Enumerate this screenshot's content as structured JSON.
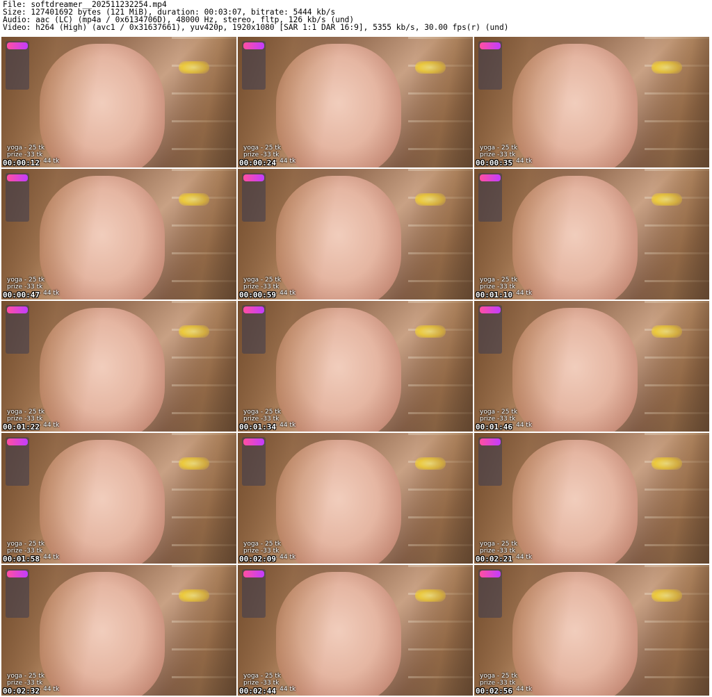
{
  "header": {
    "file": "File: softdreamer__202511232254.mp4",
    "size": "Size: 127401692 bytes (121 MiB), duration: 00:03:07, bitrate: 5444 kb/s",
    "audio": "Audio: aac (LC) (mp4a / 0x6134706D), 48000 Hz, stereo, fltp, 126 kb/s (und)",
    "video": "Video: h264 (High) (avc1 / 0x31637661), yuv420p, 1920x1080 [SAR 1:1 DAR 16:9], 5355 kb/s, 30.00 fps(r) (und)"
  },
  "overlay": {
    "line1": "yoga - 25 tk",
    "line2": "prize -33 tk",
    "line3": "- 44 tk"
  },
  "thumbnails": [
    {
      "timestamp": "00:00:12"
    },
    {
      "timestamp": "00:00:24"
    },
    {
      "timestamp": "00:00:35"
    },
    {
      "timestamp": "00:00:47"
    },
    {
      "timestamp": "00:00:59"
    },
    {
      "timestamp": "00:01:10"
    },
    {
      "timestamp": "00:01:22"
    },
    {
      "timestamp": "00:01:34"
    },
    {
      "timestamp": "00:01:46"
    },
    {
      "timestamp": "00:01:58"
    },
    {
      "timestamp": "00:02:09"
    },
    {
      "timestamp": "00:02:21"
    },
    {
      "timestamp": "00:02:32"
    },
    {
      "timestamp": "00:02:44"
    },
    {
      "timestamp": "00:02:56"
    }
  ]
}
